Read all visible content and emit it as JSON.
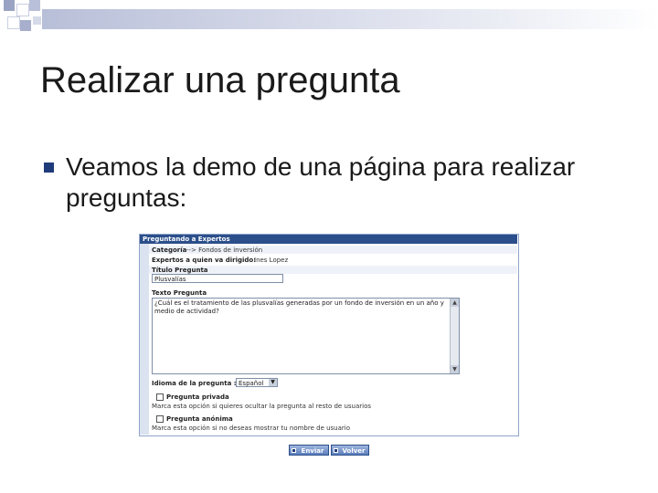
{
  "slide": {
    "title": "Realizar una pregunta",
    "bullet": "Veamos la demo de una página para realizar preguntas:"
  },
  "form": {
    "header": "Preguntando a Expertos",
    "categoria_label": "Categoría",
    "categoria_value": "--> Fondos de inversión",
    "expertos_label": "Expertos a quien va dirigido:",
    "expertos_value": "Ines Lopez",
    "titulo_label": "Título Pregunta",
    "titulo_value": "Plusvalías",
    "texto_label": "Texto Pregunta",
    "texto_value": "¿Cuál es el tratamiento de las plusvalías generadas por un fondo de inversión en un año y medio de actividad?",
    "idioma_label": "Idioma de la pregunta :",
    "idioma_value": "Español",
    "privada_label": "Pregunta privada",
    "privada_help": "Marca esta opción si quieres ocultar la pregunta al resto de usuarios",
    "anonima_label": "Pregunta anónima",
    "anonima_help": "Marca esta opción si no deseas mostrar tu nombre de usuario",
    "enviar_label": "Enviar",
    "volver_label": "Volver"
  },
  "colors": {
    "bullet": "#1f3b7a",
    "form_header": "#2b4f8a"
  }
}
